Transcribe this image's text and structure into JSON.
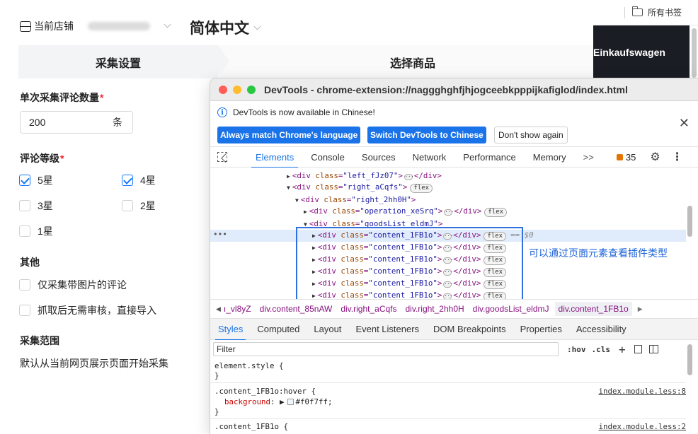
{
  "panel": {
    "store_label": "当前店铺",
    "language": "简体中文",
    "steps": [
      "采集设置",
      "选择商品"
    ],
    "review_count_label": "单次采集评论数量",
    "review_count_value": "200",
    "review_count_unit": "条",
    "rating_label": "评论等级",
    "ratings": [
      {
        "label": "5星",
        "checked": true
      },
      {
        "label": "4星",
        "checked": true
      },
      {
        "label": "3星",
        "checked": false
      },
      {
        "label": "2星",
        "checked": false
      },
      {
        "label": "1星",
        "checked": false
      }
    ],
    "other_label": "其他",
    "other_options": [
      "仅采集带图片的评论",
      "抓取后无需审核，直接导入"
    ],
    "range_label": "采集范围",
    "range_text": "默认从当前网页展示页面开始采集"
  },
  "browser": {
    "bookmarks_label": "所有书签",
    "site_heading": "Einkaufswagen"
  },
  "devtools": {
    "title": "DevTools - chrome-extension://naggghghfjhjogceebkpppijkafiglod/index.html",
    "info_text": "DevTools is now available in Chinese!",
    "info_buttons": [
      "Always match Chrome's language",
      "Switch DevTools to Chinese",
      "Don't show again"
    ],
    "tabs": [
      "Elements",
      "Console",
      "Sources",
      "Network",
      "Performance",
      "Memory"
    ],
    "more_tabs": ">>",
    "issue_count": "35",
    "dom": [
      {
        "indent": 1,
        "toggle": "▶",
        "cls": "left_fJz07",
        "collapsed": true,
        "flex": false
      },
      {
        "indent": 1,
        "toggle": "▼",
        "cls": "right_aCqfs",
        "collapsed": false,
        "flex": true
      },
      {
        "indent": 2,
        "toggle": "▼",
        "cls": "right_2hh0H",
        "collapsed": false,
        "flex": false
      },
      {
        "indent": 3,
        "toggle": "▶",
        "cls": "operation_xeSrq",
        "collapsed": true,
        "flex": true
      },
      {
        "indent": 3,
        "toggle": "▼",
        "cls": "goodsList_eldmJ",
        "collapsed": false,
        "flex": false
      },
      {
        "indent": 4,
        "toggle": "▶",
        "cls": "content_1FB1o",
        "collapsed": true,
        "flex": true,
        "selected": true
      },
      {
        "indent": 4,
        "toggle": "▶",
        "cls": "content_1FB1o",
        "collapsed": true,
        "flex": true
      },
      {
        "indent": 4,
        "toggle": "▶",
        "cls": "content_1FB1o",
        "collapsed": true,
        "flex": true
      },
      {
        "indent": 4,
        "toggle": "▶",
        "cls": "content_1FB1o",
        "collapsed": true,
        "flex": true
      },
      {
        "indent": 4,
        "toggle": "▶",
        "cls": "content_1FB1o",
        "collapsed": true,
        "flex": true
      },
      {
        "indent": 4,
        "toggle": "▶",
        "cls": "content_1FB1o",
        "collapsed": true,
        "flex": true
      }
    ],
    "selected_marker": "== $0",
    "callout": "可以通过页面元素查看插件类型",
    "breadcrumbs": [
      "ı_vl8yZ",
      "div.content_85nAW",
      "div.right_aCqfs",
      "div.right_2hh0H",
      "div.goodsList_eldmJ",
      "div.content_1FB1o"
    ],
    "style_tabs": [
      "Styles",
      "Computed",
      "Layout",
      "Event Listeners",
      "DOM Breakpoints",
      "Properties",
      "Accessibility"
    ],
    "filter_placeholder": "Filter",
    "filter_tools": [
      ":hov",
      ".cls"
    ],
    "css": {
      "element_style": "element.style {",
      "close": "}",
      "hover_selector": ".content_1FB1o:hover {",
      "hover_src": "index.module.less:8",
      "hover_prop": "background",
      "hover_value": "#f0f7ff;",
      "base_selector": ".content_1FB1o {",
      "base_src": "index.module.less:2"
    }
  }
}
